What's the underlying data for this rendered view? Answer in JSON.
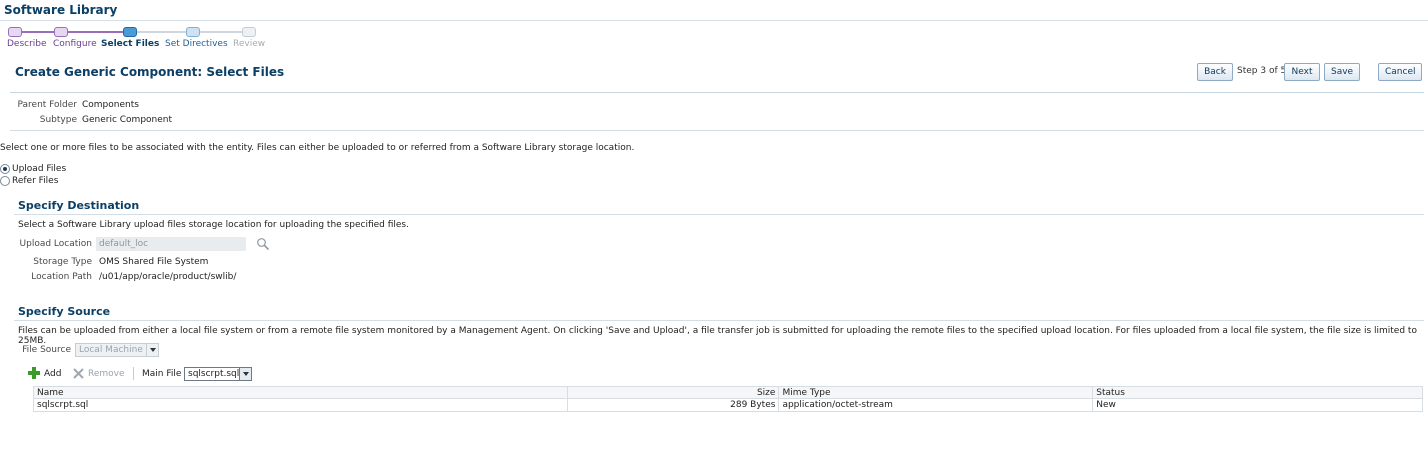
{
  "app": {
    "title": "Software Library"
  },
  "train": {
    "steps": [
      {
        "label": "Describe",
        "state": "visited"
      },
      {
        "label": "Configure",
        "state": "visited"
      },
      {
        "label": "Select Files",
        "state": "current"
      },
      {
        "label": "Set Directives",
        "state": "next"
      },
      {
        "label": "Review",
        "state": "future"
      }
    ]
  },
  "header": {
    "title": "Create Generic Component: Select Files",
    "back_label": "Back",
    "step_text": "Step 3 of 5",
    "next_label": "Next",
    "save_label": "Save",
    "cancel_label": "Cancel"
  },
  "info": {
    "parent_folder_label": "Parent Folder",
    "parent_folder_value": "Components",
    "subtype_label": "Subtype",
    "subtype_value": "Generic Component"
  },
  "intro_text": "Select one or more files to be associated with the entity. Files can either be uploaded to or referred from a Software Library storage location.",
  "mode": {
    "options": [
      "Upload Files",
      "Refer Files"
    ],
    "selected": "Upload Files"
  },
  "destination": {
    "title": "Specify Destination",
    "description": "Select a Software Library upload files storage location for uploading the specified files.",
    "upload_location_label": "Upload Location",
    "upload_location_value": "default_loc",
    "storage_type_label": "Storage Type",
    "storage_type_value": "OMS Shared File System",
    "location_path_label": "Location Path",
    "location_path_value": "/u01/app/oracle/product/swlib/"
  },
  "source": {
    "title": "Specify Source",
    "description": "Files can be uploaded from either a local file system or from a remote file system monitored by a Management Agent. On clicking 'Save and Upload', a file transfer job is submitted for uploading the remote files to the specified upload location. For files uploaded from a local file system, the file size is limited to 25MB.",
    "file_source_label": "File Source",
    "file_source_value": "Local Machine",
    "add_label": "Add",
    "remove_label": "Remove",
    "main_file_label": "Main File",
    "main_file_value": "sqlscrpt.sql"
  },
  "files_table": {
    "columns": [
      "Name",
      "Size",
      "Mime Type",
      "Status"
    ],
    "rows": [
      {
        "name": "sqlscrpt.sql",
        "size": "289 Bytes",
        "mime": "application/octet-stream",
        "status": "New"
      }
    ]
  },
  "colors": {
    "brand": "#0b3f66",
    "train_visited": "#9a6fb8",
    "train_current": "#4a9bd6",
    "add_icon": "#3a9a2a"
  }
}
